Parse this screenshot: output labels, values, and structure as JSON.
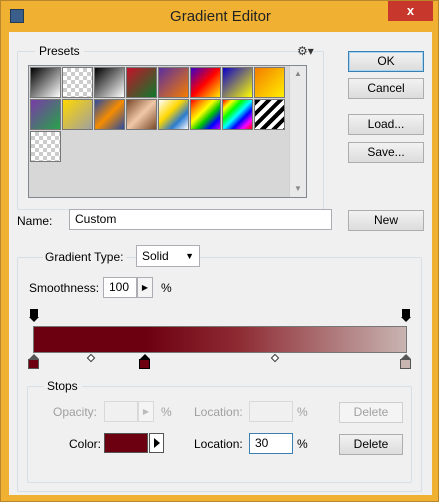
{
  "window": {
    "title": "Gradient Editor",
    "close_glyph": "x"
  },
  "presets": {
    "label": "Presets",
    "gear_glyph": "⚙▾",
    "swatches": [
      "linear-gradient(135deg,#000 0%,#fff 100%)",
      "repeating-conic-gradient(#ccc 0 25%,#fff 0 50%) 0 0/8px 8px",
      "linear-gradient(135deg,#000 0%,#fff 100%)",
      "linear-gradient(135deg,#c4122a 0%,#0b7a2a 100%)",
      "linear-gradient(135deg,#5a2fa0 0%,#f57c00 100%)",
      "linear-gradient(135deg,#3a00c8 0%,#ff0000 50%,#ffef00 100%)",
      "linear-gradient(135deg,#0b00c8 0%,#ffff00 100%)",
      "linear-gradient(135deg,#f57c00 0%,#ffef00 100%)",
      "linear-gradient(135deg,#7a3aa8 0%,#27a34a 100%)",
      "linear-gradient(135deg,#ffd700 0%,#a0a0a0 100%)",
      "linear-gradient(135deg,#2a4aa0 0%,#f58c00 50%,#2a4aa0 100%)",
      "linear-gradient(135deg,#7a4a2a 0%,#f0c8a8 50%,#7a4a2a 100%)",
      "linear-gradient(135deg,#ffffff 0%,#ffd700 40%,#2a7ad0 70%,#ffffff 100%)",
      "linear-gradient(135deg,#ff0000,#ff8c00,#ffff00,#00c800,#0000ff,#c800ff)",
      "linear-gradient(135deg,#ff0000,#ffff00,#00ff00,#00ffff,#0000ff,#ff00ff,#ff0000)",
      "repeating-linear-gradient(135deg,#000 0 4px,#fff 4px 8px)",
      "repeating-conic-gradient(#ccc 0 25%,#fff 0 50%) 0 0/8px 8px"
    ]
  },
  "buttons": {
    "ok": "OK",
    "cancel": "Cancel",
    "load": "Load...",
    "save": "Save...",
    "new": "New",
    "delete_opacity": "Delete",
    "delete_color": "Delete"
  },
  "name": {
    "label": "Name:",
    "value": "Custom"
  },
  "gradient": {
    "type_label": "Gradient Type:",
    "type_value": "Solid",
    "smoothness_label": "Smoothness:",
    "smoothness_value": "100",
    "smoothness_unit": "%"
  },
  "stops": {
    "label": "Stops",
    "opacity_label": "Opacity:",
    "opacity_value": "",
    "opacity_unit": "%",
    "opacity_location_label": "Location:",
    "opacity_location_value": "",
    "opacity_location_unit": "%",
    "color_label": "Color:",
    "color_value": "#6d0010",
    "color_location_label": "Location:",
    "color_location_value": "30",
    "color_location_unit": "%"
  },
  "colors": {
    "stop_left": "#6d0010",
    "stop_mid": "#6d0010",
    "stop_right": "#c8b4b1"
  }
}
